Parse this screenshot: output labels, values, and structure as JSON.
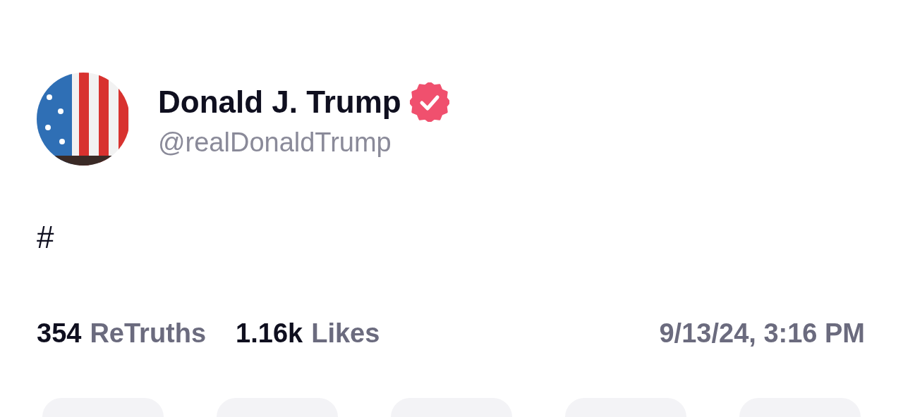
{
  "author": {
    "name": "Donald J. Trump",
    "verified": true,
    "handle": "@realDonaldTrump"
  },
  "post": {
    "text": "#"
  },
  "stats": [
    {
      "count": "354",
      "label": "ReTruths"
    },
    {
      "count": "1.16k",
      "label": "Likes"
    }
  ],
  "timestamp": "9/13/24, 3:16 PM",
  "actions": [
    {
      "kind": "button"
    },
    {
      "kind": "button"
    },
    {
      "kind": "button"
    },
    {
      "kind": "button"
    },
    {
      "kind": "button"
    }
  ]
}
